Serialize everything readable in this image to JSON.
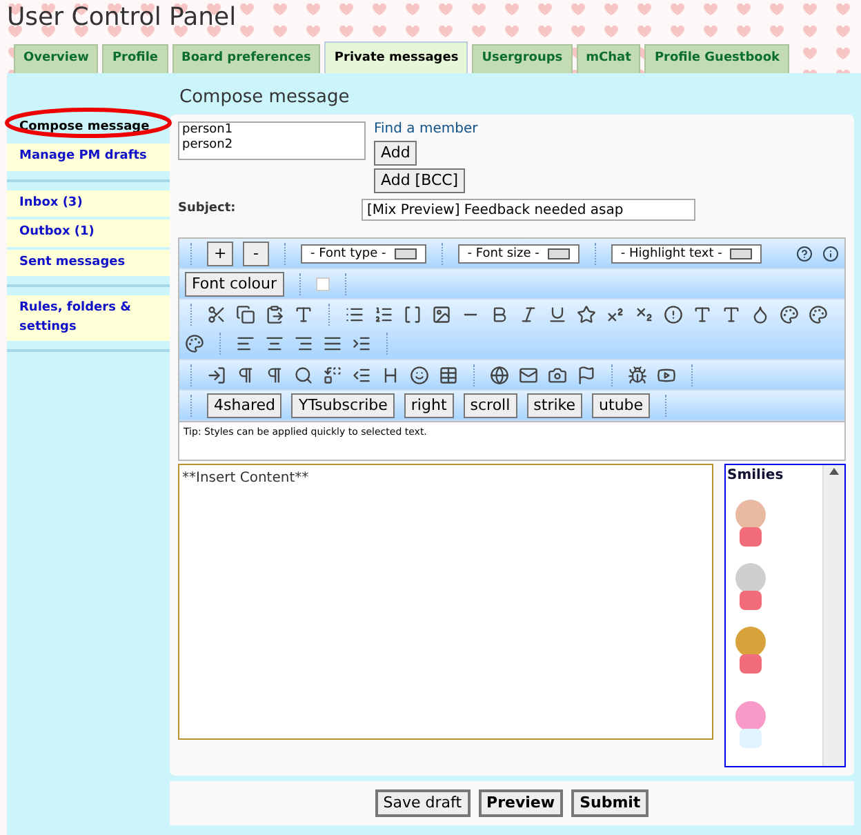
{
  "title": "User Control Panel",
  "tabs": [
    {
      "label": "Overview",
      "selected": false
    },
    {
      "label": "Profile",
      "selected": false
    },
    {
      "label": "Board preferences",
      "selected": false
    },
    {
      "label": "Private messages",
      "selected": true
    },
    {
      "label": "Usergroups",
      "selected": false
    },
    {
      "label": "mChat",
      "selected": false
    },
    {
      "label": "Profile Guestbook",
      "selected": false
    }
  ],
  "sidebar": {
    "groups": [
      [
        {
          "label": "Compose message",
          "selected": true
        },
        {
          "label": "Manage PM drafts",
          "selected": false
        }
      ],
      [
        {
          "label": "Inbox (3)",
          "selected": false
        },
        {
          "label": "Outbox (1)",
          "selected": false
        },
        {
          "label": "Sent messages",
          "selected": false
        }
      ],
      [
        {
          "label": "Rules, folders & settings",
          "selected": false
        }
      ]
    ]
  },
  "heading": "Compose message",
  "recipients": {
    "value": "person1\nperson2"
  },
  "find_member": "Find a member",
  "add_buttons": [
    "Add",
    "Add [BCC]"
  ],
  "subject": {
    "label": "Subject:",
    "value": "[Mix Preview] Feedback needed asap"
  },
  "toolbar": {
    "size_buttons": [
      "+",
      "-"
    ],
    "selects": [
      "- Font type -",
      "- Font size -",
      "- Highlight text -"
    ],
    "font_colour": "Font colour",
    "custom_buttons": [
      "4shared",
      "YTsubscribe",
      "right",
      "scroll",
      "strike",
      "utube"
    ],
    "tip": "Tip: Styles can be applied quickly to selected text."
  },
  "message": {
    "value": "**Insert Content**"
  },
  "smilies": {
    "title": "Smilies"
  },
  "buttons": [
    {
      "label": "Save draft",
      "kind": "plain"
    },
    {
      "label": "Preview",
      "kind": "bold"
    },
    {
      "label": "Submit",
      "kind": "bold"
    }
  ]
}
